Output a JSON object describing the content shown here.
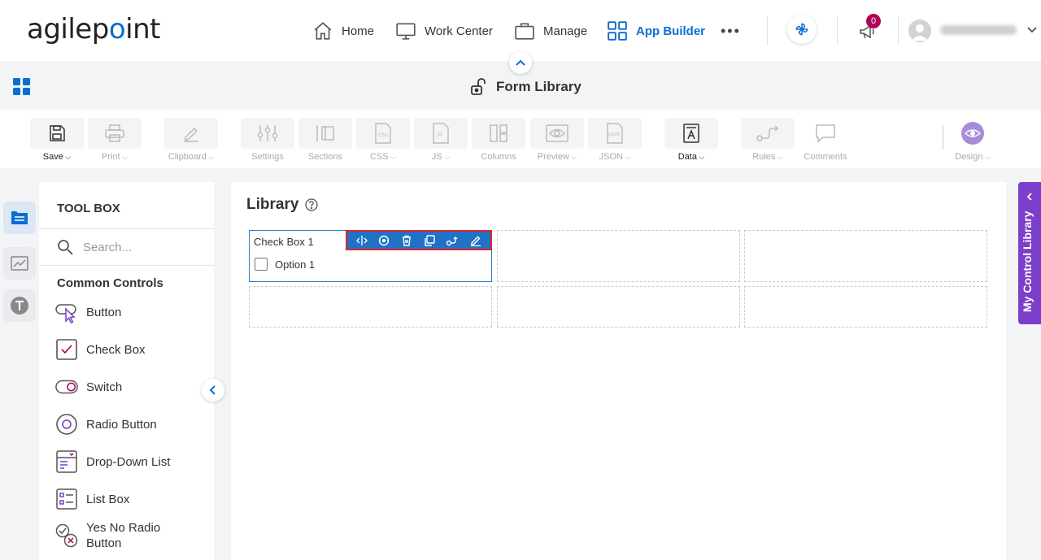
{
  "app": {
    "logo": {
      "pre": "agilep",
      "mark": "o",
      "post": "int"
    }
  },
  "nav": {
    "items": [
      {
        "label": "Home",
        "icon": "home-icon"
      },
      {
        "label": "Work Center",
        "icon": "monitor-icon"
      },
      {
        "label": "Manage",
        "icon": "briefcase-icon"
      },
      {
        "label": "App Builder",
        "icon": "grid-icon",
        "active": true
      }
    ],
    "more": "•••",
    "notification_count": "0"
  },
  "header": {
    "title": "Form Library"
  },
  "ribbon": {
    "items": [
      {
        "label": "Save",
        "chevron": true,
        "enabled": true
      },
      {
        "label": "Print",
        "chevron": true,
        "enabled": false
      },
      {
        "label": "Clipboard",
        "chevron": true,
        "enabled": false
      },
      {
        "label": "Settings",
        "chevron": false,
        "enabled": false
      },
      {
        "label": "Sections",
        "chevron": false,
        "enabled": false
      },
      {
        "label": "CSS",
        "chevron": true,
        "enabled": false
      },
      {
        "label": "JS",
        "chevron": true,
        "enabled": false
      },
      {
        "label": "Columns",
        "chevron": false,
        "enabled": false
      },
      {
        "label": "Preview",
        "chevron": true,
        "enabled": false
      },
      {
        "label": "JSON",
        "chevron": true,
        "enabled": false
      },
      {
        "label": "Data",
        "chevron": true,
        "enabled": true
      },
      {
        "label": "Rules",
        "chevron": true,
        "enabled": false
      },
      {
        "label": "Comments",
        "chevron": false,
        "enabled": false
      },
      {
        "label": "Design",
        "chevron": true,
        "enabled": false
      }
    ]
  },
  "toolbox": {
    "title": "TOOL BOX",
    "search_placeholder": "Search...",
    "group": "Common Controls",
    "items": [
      "Button",
      "Check Box",
      "Switch",
      "Radio Button",
      "Drop-Down List",
      "List Box",
      "Yes No Radio Button"
    ]
  },
  "canvas": {
    "title": "Library",
    "control": {
      "label": "Check Box 1",
      "option": "Option 1"
    }
  },
  "right_tab": {
    "label": "My Control Library"
  },
  "colors": {
    "accent": "#0a6ed1",
    "purple": "#7b3fc9",
    "badge": "#b0005a",
    "selection": "#e0252a"
  }
}
